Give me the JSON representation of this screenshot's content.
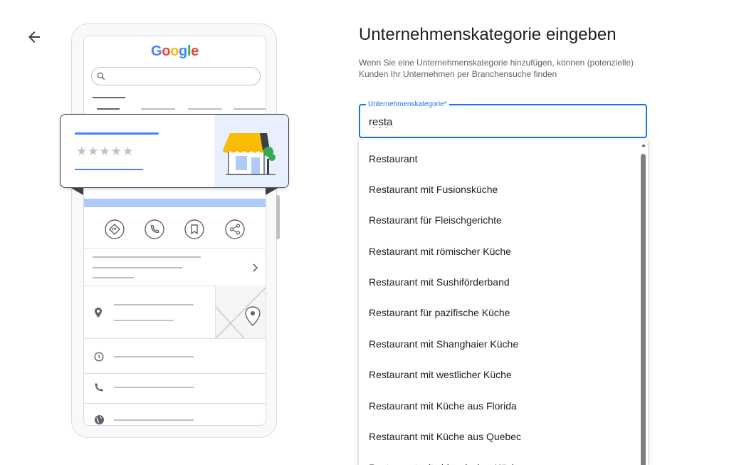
{
  "nav": {
    "back_icon": "arrow-back-icon"
  },
  "illustration": {
    "logo_letters": [
      {
        "char": "G",
        "color": "#4285F4"
      },
      {
        "char": "o",
        "color": "#EA4335"
      },
      {
        "char": "o",
        "color": "#FBBC05"
      },
      {
        "char": "g",
        "color": "#4285F4"
      },
      {
        "char": "l",
        "color": "#34A853"
      },
      {
        "char": "e",
        "color": "#EA4335"
      }
    ],
    "rating_stars": "★★★★★",
    "icons": [
      "search-icon",
      "directions-icon",
      "phone-icon",
      "bookmark-icon",
      "share-icon",
      "chevron-right-icon",
      "location-pin-icon",
      "clock-icon",
      "phone-icon",
      "globe-icon",
      "storefront-icon"
    ],
    "colors": {
      "accent_blue": "#4285F4",
      "awning_yellow": "#FBBC05",
      "tree_green": "#34A853"
    }
  },
  "form": {
    "title": "Unternehmenskategorie eingeben",
    "description": "Wenn Sie eine Unternehmenskategorie hinzufügen, können (potenzielle) Kunden Ihr Unternehmen per Branchensuche finden",
    "field_label": "Unternehmenskategorie*",
    "field_value": "resta",
    "accent_color": "#1A73E8",
    "suggestions": [
      "Restaurant",
      "Restaurant mit Fusionsküche",
      "Restaurant für Fleischgerichte",
      "Restaurant mit römischer Küche",
      "Restaurant mit Sushiförderband",
      "Restaurant für pazifische Küche",
      "Restaurant mit Shanghaier Küche",
      "Restaurant mit westlicher Küche",
      "Restaurant mit Küche aus Florida",
      "Restaurant mit Küche aus Quebec",
      "Restaurant mit chinesischer Küche"
    ]
  }
}
